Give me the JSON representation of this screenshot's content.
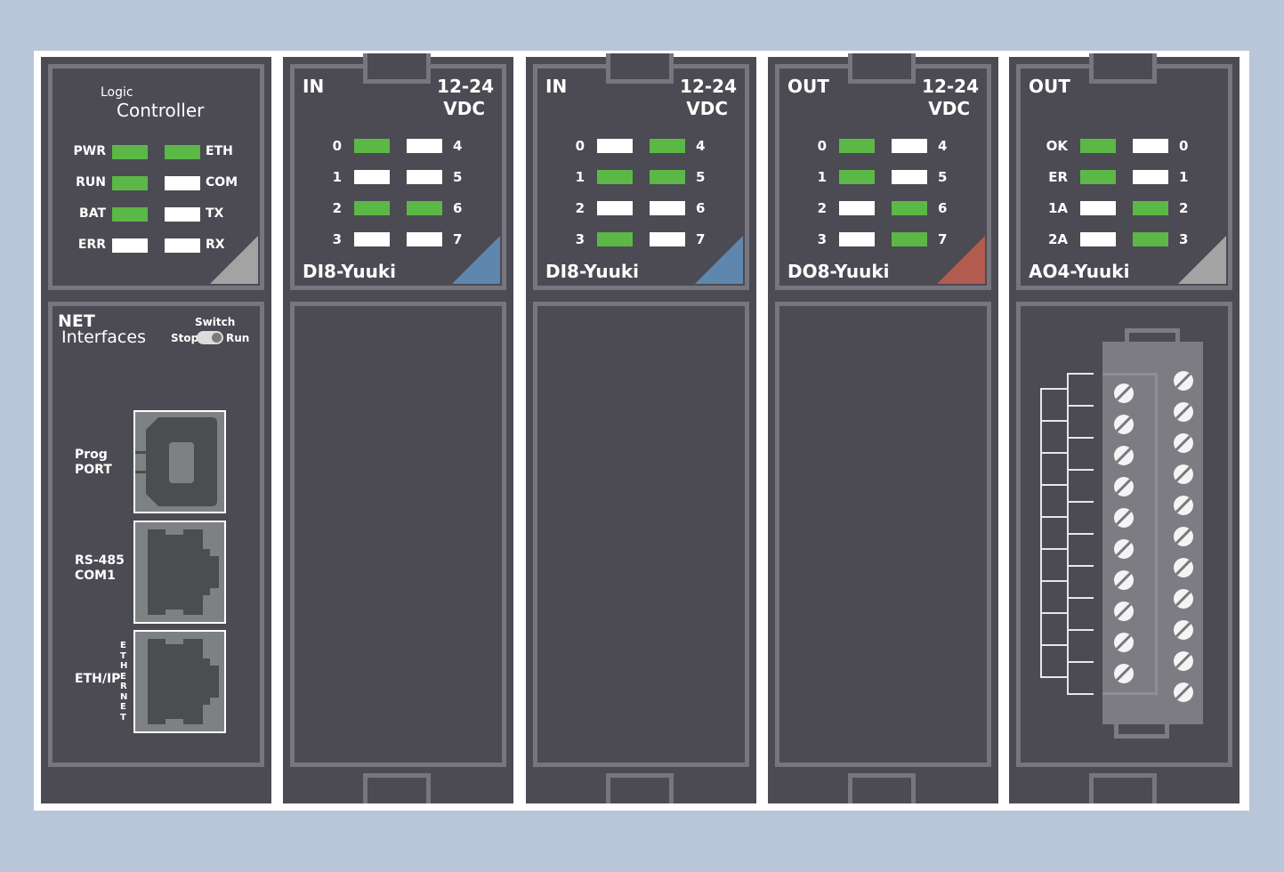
{
  "colors": {
    "background": "#b9c5d9",
    "module_body": "#4c4a52",
    "panel_border": "#77757d",
    "led_on": "#5bb847",
    "led_off": "#ffffff",
    "accent_input": "#5f87ad",
    "accent_output": "#b25c50",
    "accent_neutral": "#a3a3a3"
  },
  "controller": {
    "title_small": "Logic",
    "title_large": "Controller",
    "leds_left": [
      {
        "label": "PWR",
        "state": "on"
      },
      {
        "label": "RUN",
        "state": "on"
      },
      {
        "label": "BAT",
        "state": "on"
      },
      {
        "label": "ERR",
        "state": "off"
      }
    ],
    "leds_right": [
      {
        "label": "ETH",
        "state": "on"
      },
      {
        "label": "COM",
        "state": "off"
      },
      {
        "label": "TX",
        "state": "off"
      },
      {
        "label": "RX",
        "state": "off"
      }
    ],
    "net_title_line1": "NET",
    "net_title_line2": "Interfaces",
    "switch": {
      "label": "Switch",
      "left": "Stop",
      "right": "Run",
      "position": "Run"
    },
    "ports": [
      {
        "label_line1": "Prog",
        "label_line2": "PORT",
        "type": "usb-b"
      },
      {
        "label_line1": "RS-485",
        "label_line2": "COM1",
        "type": "rj45"
      },
      {
        "label_line1": "ETH/IP",
        "label_line2": "",
        "type": "rj45",
        "vertical_label": "ETHERNET"
      }
    ]
  },
  "modules": [
    {
      "direction": "IN",
      "voltage_line1": "12-24",
      "voltage_line2": "VDC",
      "name": "DI8-Yuuki",
      "accent": "input",
      "left": [
        {
          "label": "0",
          "state": "on"
        },
        {
          "label": "1",
          "state": "off"
        },
        {
          "label": "2",
          "state": "on"
        },
        {
          "label": "3",
          "state": "off"
        }
      ],
      "right": [
        {
          "label": "4",
          "state": "off"
        },
        {
          "label": "5",
          "state": "off"
        },
        {
          "label": "6",
          "state": "on"
        },
        {
          "label": "7",
          "state": "off"
        }
      ]
    },
    {
      "direction": "IN",
      "voltage_line1": "12-24",
      "voltage_line2": "VDC",
      "name": "DI8-Yuuki",
      "accent": "input",
      "left": [
        {
          "label": "0",
          "state": "off"
        },
        {
          "label": "1",
          "state": "on"
        },
        {
          "label": "2",
          "state": "off"
        },
        {
          "label": "3",
          "state": "on"
        }
      ],
      "right": [
        {
          "label": "4",
          "state": "on"
        },
        {
          "label": "5",
          "state": "on"
        },
        {
          "label": "6",
          "state": "off"
        },
        {
          "label": "7",
          "state": "off"
        }
      ]
    },
    {
      "direction": "OUT",
      "voltage_line1": "12-24",
      "voltage_line2": "VDC",
      "name": "DO8-Yuuki",
      "accent": "output",
      "left": [
        {
          "label": "0",
          "state": "on"
        },
        {
          "label": "1",
          "state": "on"
        },
        {
          "label": "2",
          "state": "off"
        },
        {
          "label": "3",
          "state": "off"
        }
      ],
      "right": [
        {
          "label": "4",
          "state": "off"
        },
        {
          "label": "5",
          "state": "off"
        },
        {
          "label": "6",
          "state": "on"
        },
        {
          "label": "7",
          "state": "on"
        }
      ]
    },
    {
      "direction": "OUT",
      "voltage_line1": "",
      "voltage_line2": "",
      "name": "AO4-Yuuki",
      "accent": "neutral",
      "left": [
        {
          "label": "OK",
          "state": "on"
        },
        {
          "label": "ER",
          "state": "on"
        },
        {
          "label": "1A",
          "state": "off"
        },
        {
          "label": "2A",
          "state": "off"
        }
      ],
      "right": [
        {
          "label": "0",
          "state": "off"
        },
        {
          "label": "1",
          "state": "off"
        },
        {
          "label": "2",
          "state": "on"
        },
        {
          "label": "3",
          "state": "on"
        }
      ]
    }
  ],
  "terminal_block": {
    "left_screws": 10,
    "right_screws": 11
  }
}
